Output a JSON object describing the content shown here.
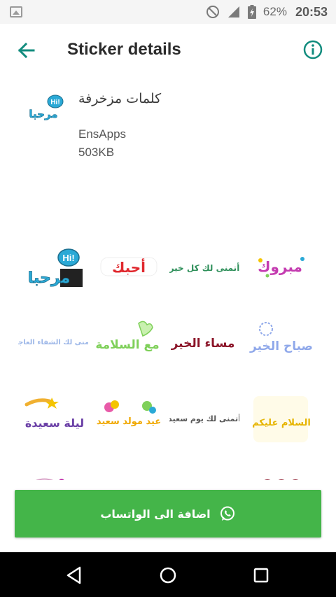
{
  "status_bar": {
    "battery_percent": "62%",
    "time": "20:53",
    "icons": [
      "gallery-icon",
      "do-not-disturb-icon",
      "signal-icon",
      "battery-charging-icon"
    ]
  },
  "app_bar": {
    "title": "Sticker details",
    "back_icon": "arrow-left-icon",
    "info_icon": "info-icon"
  },
  "pack": {
    "name": "كلمات مزخرفة",
    "publisher": "EnsApps",
    "size": "503KB",
    "tray_text": "مرحبا",
    "tray_badge": "Hi!"
  },
  "stickers": [
    {
      "text": "مرحبا",
      "badge": "Hi!",
      "color": "#2aa9d6"
    },
    {
      "text": "أحبك",
      "color": "#e0282e"
    },
    {
      "text": "أتمنى لك كل خير",
      "color": "#2e8f5a"
    },
    {
      "text": "مبروك",
      "color": "#c43bb0"
    },
    {
      "text": "أتمنى لك الشفاء العاجل",
      "color": "#9db7e8"
    },
    {
      "text": "مع السلامة",
      "color": "#7fd05a"
    },
    {
      "text": "مساء الخير",
      "color": "#8b1428"
    },
    {
      "text": "صباح الخير",
      "color": "#8fa8ea"
    },
    {
      "text": "ليلة سعيدة",
      "color": "#6a3fa6"
    },
    {
      "text": "عيد مولد سعيد",
      "color": "#f0a800"
    },
    {
      "text": "أتمنى لك يوم سعيد",
      "color": "#555555"
    },
    {
      "text": "السلام عليكم",
      "color": "#e6b400"
    }
  ],
  "add_button": {
    "label": "اضافة الى الواتساب",
    "icon": "whatsapp-icon"
  },
  "nav_bar": {
    "icons": [
      "back-triangle-icon",
      "home-circle-icon",
      "recents-square-icon"
    ]
  },
  "colors": {
    "accent": "#128c7e",
    "button_green": "#44b549",
    "status_bar": "#f5f5f5"
  }
}
